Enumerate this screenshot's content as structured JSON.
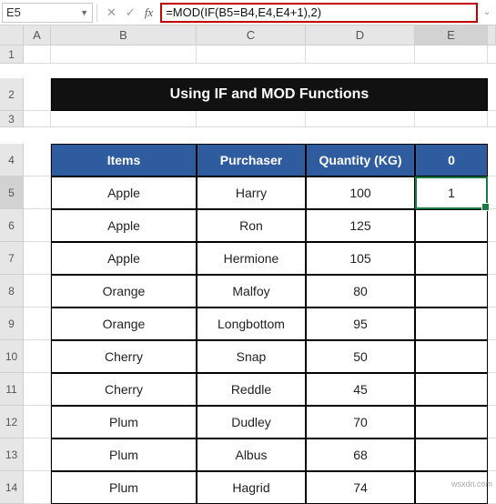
{
  "formula_bar": {
    "name_box": "E5",
    "cancel": "✕",
    "confirm": "✓",
    "fx": "fx",
    "formula": "=MOD(IF(B5=B4,E4,E4+1),2)"
  },
  "columns": {
    "A": "A",
    "B": "B",
    "C": "C",
    "D": "D",
    "E": "E"
  },
  "rows": [
    "1",
    "2",
    "3",
    "4",
    "5",
    "6",
    "7",
    "8",
    "9",
    "10",
    "11",
    "12",
    "13",
    "14"
  ],
  "title": "Using  IF and MOD Functions",
  "table": {
    "headers": {
      "items": "Items",
      "purchaser": "Purchaser",
      "quantity": "Quantity (KG)",
      "extra": "0"
    },
    "data": [
      {
        "items": "Apple",
        "purchaser": "Harry",
        "quantity": "100",
        "extra": "1"
      },
      {
        "items": "Apple",
        "purchaser": "Ron",
        "quantity": "125",
        "extra": ""
      },
      {
        "items": "Apple",
        "purchaser": "Hermione",
        "quantity": "105",
        "extra": ""
      },
      {
        "items": "Orange",
        "purchaser": "Malfoy",
        "quantity": "80",
        "extra": ""
      },
      {
        "items": "Orange",
        "purchaser": "Longbottom",
        "quantity": "95",
        "extra": ""
      },
      {
        "items": "Cherry",
        "purchaser": "Snap",
        "quantity": "50",
        "extra": ""
      },
      {
        "items": "Cherry",
        "purchaser": "Reddle",
        "quantity": "45",
        "extra": ""
      },
      {
        "items": "Plum",
        "purchaser": "Dudley",
        "quantity": "70",
        "extra": ""
      },
      {
        "items": "Plum",
        "purchaser": "Albus",
        "quantity": "68",
        "extra": ""
      },
      {
        "items": "Plum",
        "purchaser": "Hagrid",
        "quantity": "74",
        "extra": ""
      }
    ]
  },
  "watermark": "wsxdn.com"
}
